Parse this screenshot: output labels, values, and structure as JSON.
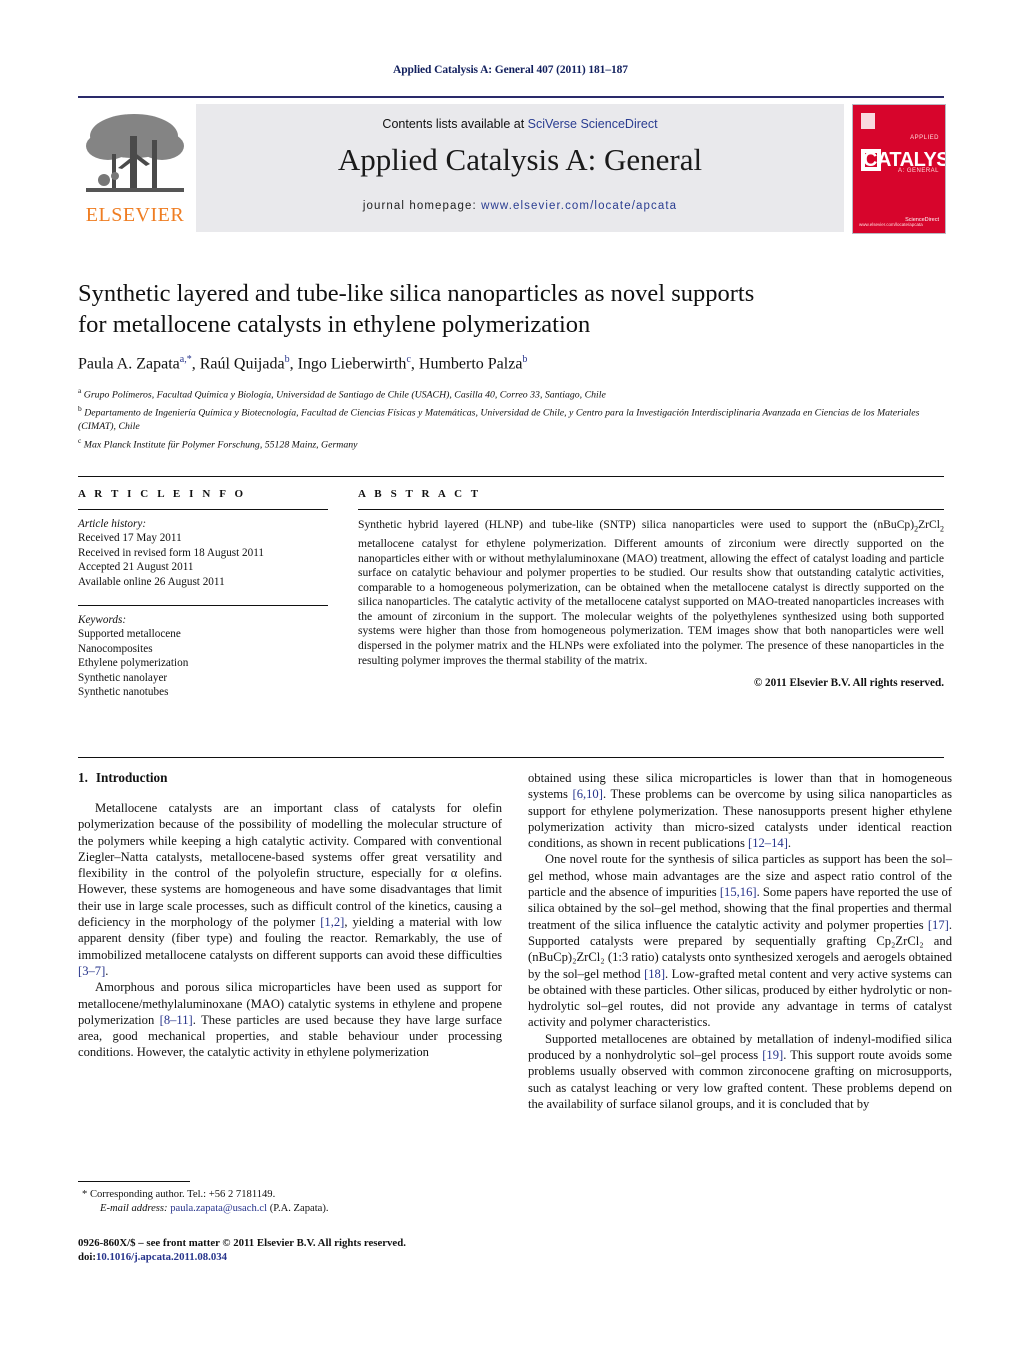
{
  "running_head": "Applied Catalysis A: General 407 (2011) 181–187",
  "masthead": {
    "publisher_name": "ELSEVIER",
    "contents_prefix": "Contents lists available at ",
    "contents_link": "SciVerse ScienceDirect",
    "journal_title": "Applied Catalysis A: General",
    "homepage_prefix": "journal homepage: ",
    "homepage_url": "www.elsevier.com/locate/apcata",
    "cover": {
      "main_word": "CATALYSIS",
      "sub_top": "APPLIED",
      "sub_bottom": "A: GENERAL",
      "footer_left": "www.elsevier.com/locate/apcata",
      "footer_right": "ScienceDirect"
    },
    "accent_color": "#2a3d91",
    "cover_color": "#d7052c",
    "elsevier_orange": "#ef7d22"
  },
  "article": {
    "title_line1": "Synthetic layered and tube-like silica nanoparticles as novel supports",
    "title_line2": "for metallocene catalysts in ethylene polymerization",
    "authors": [
      {
        "name": "Paula A. Zapata",
        "sup": "a,*"
      },
      {
        "name": "Raúl Quijada",
        "sup": "b"
      },
      {
        "name": "Ingo Lieberwirth",
        "sup": "c"
      },
      {
        "name": "Humberto Palza",
        "sup": "b"
      }
    ],
    "affiliations": [
      {
        "marker": "a",
        "text": "Grupo Polímeros, Facultad Química y Biología, Universidad de Santiago de Chile (USACH), Casilla 40, Correo 33, Santiago, Chile"
      },
      {
        "marker": "b",
        "text": "Departamento de Ingeniería Química y Biotecnología, Facultad de Ciencias Físicas y Matemáticas, Universidad de Chile, y Centro para la Investigación Interdisciplinaria Avanzada en Ciencias de los Materiales (CIMAT), Chile"
      },
      {
        "marker": "c",
        "text": "Max Planck Institute für Polymer Forschung, 55128 Mainz, Germany"
      }
    ]
  },
  "article_info": {
    "heading": "A R T I C L E   I N F O",
    "history_label": "Article history:",
    "history": [
      "Received 17 May 2011",
      "Received in revised form 18 August 2011",
      "Accepted 21 August 2011",
      "Available online 26 August 2011"
    ],
    "keywords_label": "Keywords:",
    "keywords": [
      "Supported metallocene",
      "Nanocomposites",
      "Ethylene polymerization",
      "Synthetic nanolayer",
      "Synthetic nanotubes"
    ]
  },
  "abstract": {
    "heading": "A B S T R A C T",
    "part1": "Synthetic hybrid layered (HLNP) and tube-like (SNTP) silica nanoparticles were used to support the (nBuCp)",
    "sub1": "2",
    "part2": "ZrCl",
    "sub2": "2",
    "part3": " metallocene catalyst for ethylene polymerization. Different amounts of zirconium were directly supported on the nanoparticles either with or without methylaluminoxane (MAO) treatment, allowing the effect of catalyst loading and particle surface on catalytic behaviour and polymer properties to be studied. Our results show that outstanding catalytic activities, comparable to a homogeneous polymerization, can be obtained when the metallocene catalyst is directly supported on the silica nanoparticles. The catalytic activity of the metallocene catalyst supported on MAO-treated nanoparticles increases with the amount of zirconium in the support. The molecular weights of the polyethylenes synthesized using both supported systems were higher than those from homogeneous polymerization. TEM images show that both nanoparticles were well dispersed in the polymer matrix and the HLNPs were exfoliated into the polymer. The presence of these nanoparticles in the resulting polymer improves the thermal stability of the matrix.",
    "copyright": "© 2011 Elsevier B.V. All rights reserved."
  },
  "body": {
    "section_number": "1.",
    "section_title": "Introduction",
    "left_paragraphs": [
      {
        "pre": "Metallocene catalysts are an important class of catalysts for olefin polymerization because of the possibility of modelling the molecular structure of the polymers while keeping a high catalytic activity. Compared with conventional Ziegler–Natta catalysts, metallocene-based systems offer great versatility and flexibility in the control of the polyolefin structure, especially for α olefins. However, these systems are homogeneous and have some disadvantages that limit their use in large scale processes, such as difficult control of the kinetics, causing a deficiency in the morphology of the polymer ",
        "ref1": "[1,2]",
        "mid": ", yielding a material with low apparent density (fiber type) and fouling the reactor. Remarkably, the use of immobilized metallocene catalysts on different supports can avoid these difficulties ",
        "ref2": "[3–7]",
        "post": "."
      },
      {
        "pre": "Amorphous and porous silica microparticles have been used as support for metallocene/methylaluminoxane (MAO) catalytic systems in ethylene and propene polymerization ",
        "ref1": "[8–11]",
        "mid": ". These particles are used because they have large surface area, good mechanical properties, and stable behaviour under processing conditions. However, the catalytic activity in ethylene polymerization",
        "ref2": "",
        "post": ""
      }
    ],
    "right_paragraphs": [
      {
        "pre": "obtained using these silica microparticles is lower than that in homogeneous systems ",
        "ref1": "[6,10]",
        "mid": ". These problems can be overcome by using silica nanoparticles as support for ethylene polymerization. These nanosupports present higher ethylene polymerization activity than micro-sized catalysts under identical reaction conditions, as shown in recent publications ",
        "ref2": "[12–14]",
        "post": "."
      },
      {
        "pre": "One novel route for the synthesis of silica particles as support has been the sol–gel method, whose main advantages are the size and aspect ratio control of the particle and the absence of impurities ",
        "ref1": "[15,16]",
        "mid": ". Some papers have reported the use of silica obtained by the sol–gel method, showing that the final properties and thermal treatment of the silica influence the catalytic activity and polymer properties ",
        "ref2": "[17]",
        "post": ". Supported catalysts were prepared by sequentially grafting Cp₂ZrCl₂ and (nBuCp)₂ZrCl₂ (1:3 ratio) catalysts onto synthesized xerogels and aerogels obtained by the sol–gel method ",
        "ref3": "[18]",
        "tail": ". Low-grafted metal content and very active systems can be obtained with these particles. Other silicas, produced by either hydrolytic or non-hydrolytic sol–gel routes, did not provide any advantage in terms of catalyst activity and polymer characteristics."
      },
      {
        "pre": "Supported metallocenes are obtained by metallation of indenyl-modified silica produced by a nonhydrolytic sol–gel process ",
        "ref1": "[19]",
        "mid": ". This support route avoids some problems usually observed with common zirconocene grafting on microsupports, such as catalyst leaching or very low grafted content. These problems depend on the availability of surface silanol groups, and it is concluded that by",
        "ref2": "",
        "post": ""
      }
    ]
  },
  "footnotes": {
    "corresponding": "* Corresponding author. Tel.: +56 2 7181149.",
    "email_label": "E-mail address:",
    "email": "paula.zapata@usach.cl",
    "email_suffix": " (P.A. Zapata).",
    "issn_line": "0926-860X/$ – see front matter © 2011 Elsevier B.V. All rights reserved.",
    "doi_prefix": "doi:",
    "doi": "10.1016/j.apcata.2011.08.034"
  }
}
